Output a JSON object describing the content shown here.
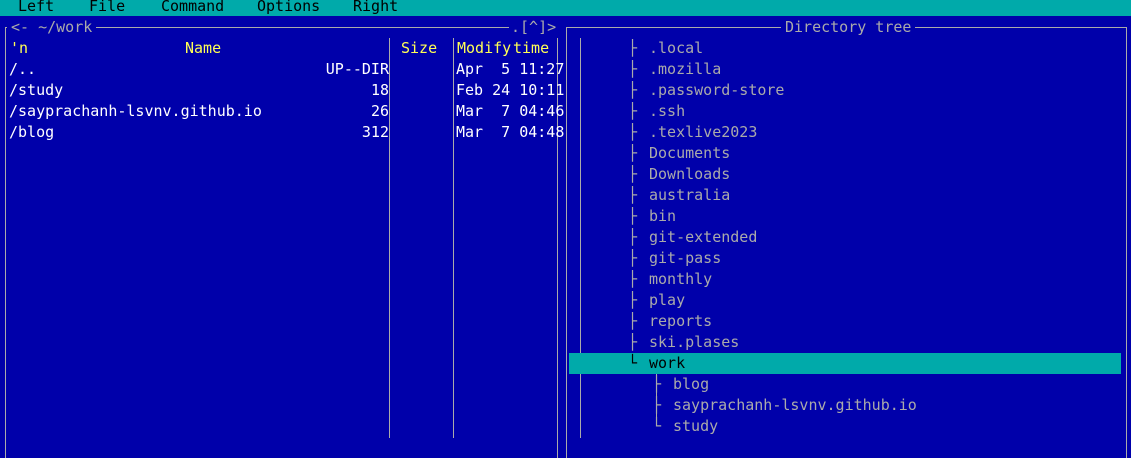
{
  "menu": [
    "Left",
    "File",
    "Command",
    "Options",
    "Right"
  ],
  "left_panel": {
    "title": "<- ~/work",
    "hotkeys": ".[^]>",
    "columns": {
      "sort": "'n",
      "name": "Name",
      "size": "Size",
      "modify": "Modify",
      "time": "time"
    },
    "rows": [
      {
        "name": "/..",
        "size": "UP--DIR",
        "date": "Apr  5 11:27"
      },
      {
        "name": "/study",
        "size": "18",
        "date": "Feb 24 10:11"
      },
      {
        "name": "/sayprachanh-lsvnv.github.io",
        "size": "26",
        "date": "Mar  7 04:46"
      },
      {
        "name": "/blog",
        "size": "312",
        "date": "Mar  7 04:48"
      }
    ]
  },
  "right_panel": {
    "title": "Directory tree",
    "items": [
      {
        "branch": "├",
        "name": ".local"
      },
      {
        "branch": "├",
        "name": ".mozilla"
      },
      {
        "branch": "├",
        "name": ".password-store"
      },
      {
        "branch": "├",
        "name": ".ssh"
      },
      {
        "branch": "├",
        "name": ".texlive2023"
      },
      {
        "branch": "├",
        "name": "Documents"
      },
      {
        "branch": "├",
        "name": "Downloads"
      },
      {
        "branch": "├",
        "name": "australia"
      },
      {
        "branch": "├",
        "name": "bin"
      },
      {
        "branch": "├",
        "name": "git-extended"
      },
      {
        "branch": "├",
        "name": "git-pass"
      },
      {
        "branch": "├",
        "name": "monthly"
      },
      {
        "branch": "├",
        "name": "play"
      },
      {
        "branch": "├",
        "name": "reports"
      },
      {
        "branch": "├",
        "name": "ski.plases"
      },
      {
        "branch": "└",
        "name": "work",
        "selected": true
      },
      {
        "branch": "├",
        "name": "blog",
        "sub": true
      },
      {
        "branch": "├",
        "name": "sayprachanh-lsvnv.github.io",
        "sub": true
      },
      {
        "branch": "└",
        "name": "study",
        "sub": true
      }
    ]
  },
  "colors": {
    "background": "#0000aa",
    "menubar": "#00aaaa",
    "header": "#ffff55",
    "text": "#ffffff",
    "dim": "#aaaaaa"
  }
}
